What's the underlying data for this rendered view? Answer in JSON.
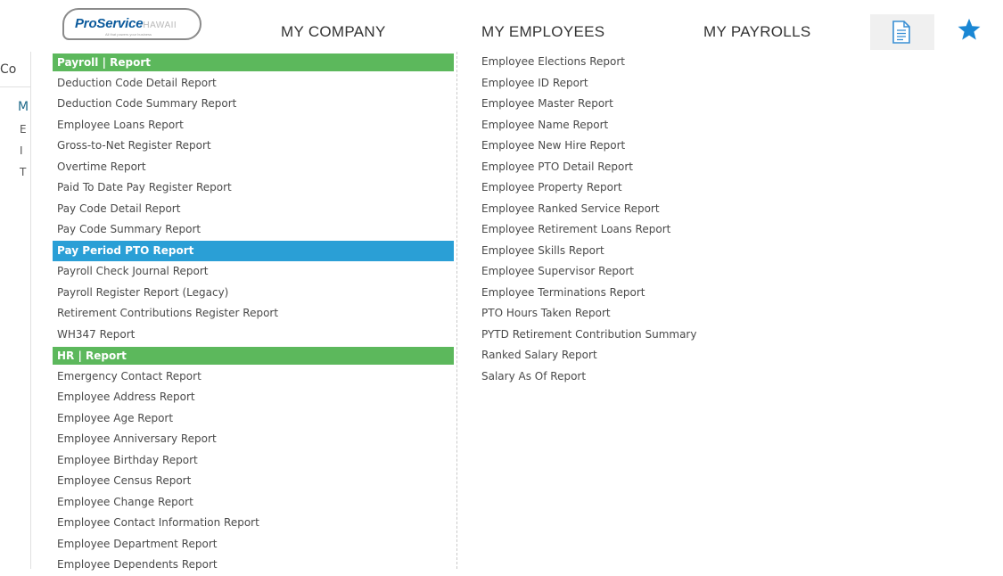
{
  "logo": {
    "brand": "ProService",
    "region": "HAWAII",
    "tagline": "All that powers your business"
  },
  "nav": {
    "my_company": "MY COMPANY",
    "my_employees": "MY EMPLOYEES",
    "my_payrolls": "MY PAYROLLS",
    "documents_icon": "document-icon",
    "favorites_icon": "star-icon"
  },
  "background_fragments": [
    "Co",
    "M",
    "E",
    "I",
    "T"
  ],
  "menu": {
    "col1": [
      {
        "label": "Payroll | Report",
        "type": "header"
      },
      {
        "label": "Deduction Code Detail Report"
      },
      {
        "label": "Deduction Code Summary Report"
      },
      {
        "label": "Employee Loans Report"
      },
      {
        "label": "Gross-to-Net Register Report"
      },
      {
        "label": "Overtime Report"
      },
      {
        "label": "Paid To Date Pay Register Report"
      },
      {
        "label": "Pay Code Detail Report"
      },
      {
        "label": "Pay Code Summary Report"
      },
      {
        "label": "Pay Period PTO Report",
        "active": true
      },
      {
        "label": "Payroll Check Journal Report"
      },
      {
        "label": "Payroll Register Report (Legacy)"
      },
      {
        "label": "Retirement Contributions Register Report"
      },
      {
        "label": "WH347 Report"
      },
      {
        "label": "HR | Report",
        "type": "header"
      },
      {
        "label": "Emergency Contact Report"
      },
      {
        "label": "Employee Address Report"
      },
      {
        "label": "Employee Age Report"
      },
      {
        "label": "Employee Anniversary Report"
      },
      {
        "label": "Employee Birthday Report"
      },
      {
        "label": "Employee Census Report"
      },
      {
        "label": "Employee Change Report"
      },
      {
        "label": "Employee Contact Information Report"
      },
      {
        "label": "Employee Department Report"
      },
      {
        "label": "Employee Dependents Report"
      }
    ],
    "col2": [
      {
        "label": "Employee Elections Report"
      },
      {
        "label": "Employee ID Report"
      },
      {
        "label": "Employee Master Report"
      },
      {
        "label": "Employee Name Report"
      },
      {
        "label": "Employee New Hire Report"
      },
      {
        "label": "Employee PTO Detail Report"
      },
      {
        "label": "Employee Property Report"
      },
      {
        "label": "Employee Ranked Service Report"
      },
      {
        "label": "Employee Retirement Loans Report"
      },
      {
        "label": "Employee Skills Report"
      },
      {
        "label": "Employee Supervisor Report"
      },
      {
        "label": "Employee Terminations Report"
      },
      {
        "label": "PTO Hours Taken Report"
      },
      {
        "label": "PYTD Retirement Contribution Summary"
      },
      {
        "label": "Ranked Salary Report"
      },
      {
        "label": "Salary As Of Report"
      }
    ]
  },
  "colors": {
    "header_green": "#5cb85c",
    "active_blue": "#2a9fd6",
    "nav_text": "#333333",
    "menu_text": "#4a4a4a",
    "star": "#1a87d4",
    "logo_blue": "#0b5a9c"
  }
}
